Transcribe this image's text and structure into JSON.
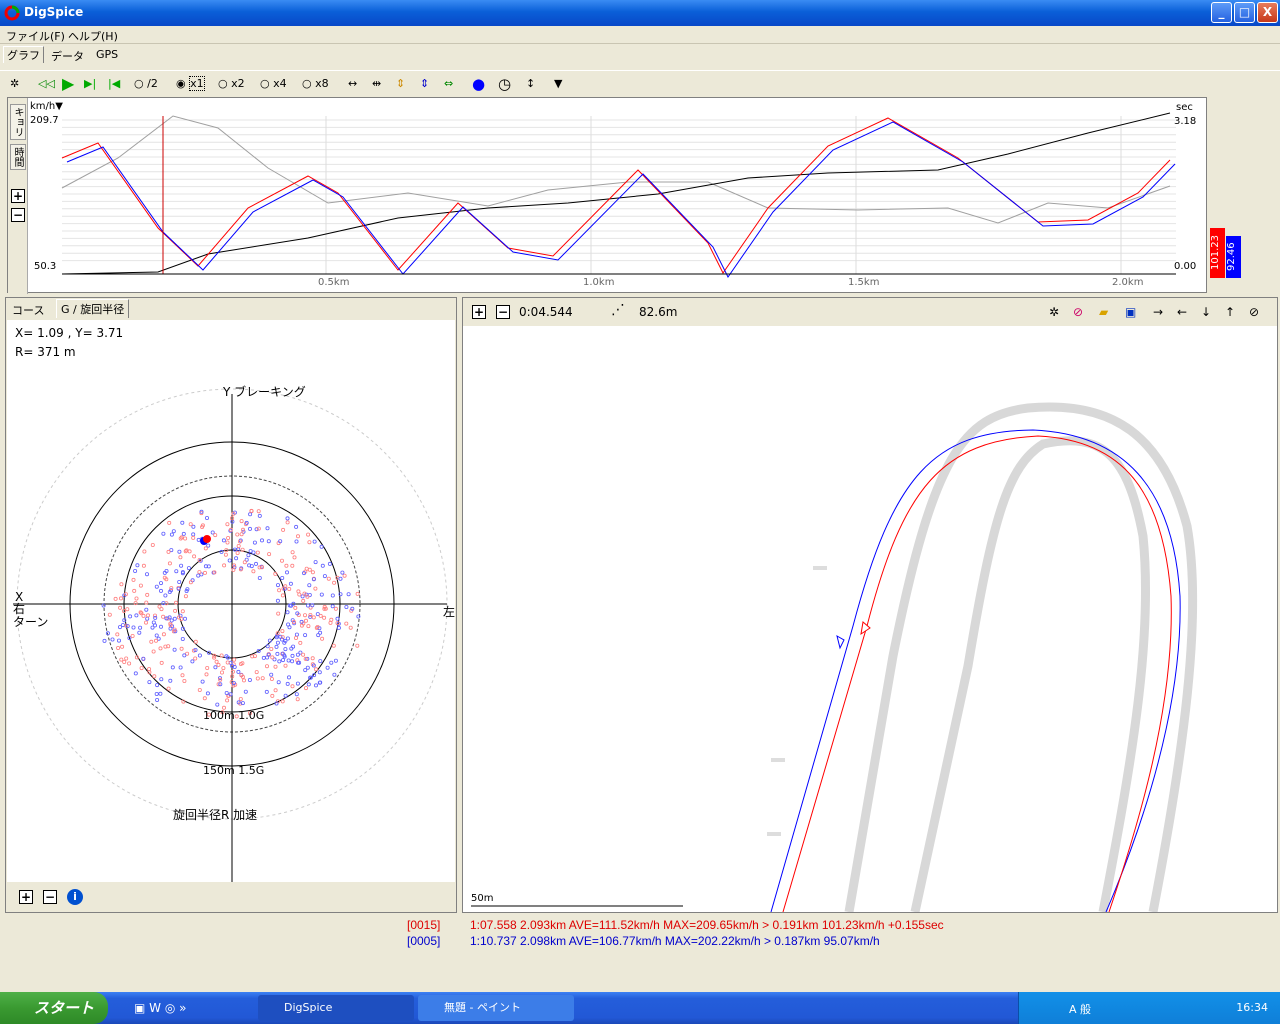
{
  "window": {
    "title": "DigSpice",
    "min": "_",
    "max": "□",
    "close": "X"
  },
  "menu": [
    {
      "label": "ファイル(F)"
    },
    {
      "label": "ヘルプ(H)"
    }
  ],
  "tabs": [
    {
      "label": "グラフ"
    },
    {
      "label": "データ"
    },
    {
      "label": "GPS"
    }
  ],
  "toolbar": {
    "speeds": [
      {
        "label": "/2"
      },
      {
        "label": "x1"
      },
      {
        "label": "x2"
      },
      {
        "label": "x4"
      },
      {
        "label": "x8"
      }
    ]
  },
  "graph": {
    "ylabel_left": "km/h▼",
    "ymax_left": "209.7",
    "ymin_left": "50.3",
    "ylabel_right": "sec",
    "ymax_right": "3.18",
    "ymin_right": "0.00",
    "vtab1": "キョリ",
    "vtab2": "時間",
    "xticks": [
      "0.5km",
      "1.0km",
      "1.5km",
      "2.0km"
    ],
    "legend_red": "101.23",
    "legend_blue": "92.46",
    "colors": {
      "red": "#ff0000",
      "blue": "#0000ff",
      "gray": "#a0a0a0",
      "black": "#000000"
    }
  },
  "gpanel": {
    "tabs": [
      {
        "label": "コース"
      },
      {
        "label": "G / 旋回半径"
      }
    ],
    "readout_xy": "X=  1.09  , Y=   3.71",
    "readout_r": "R= 371 m",
    "label_top": "Y ブレーキング",
    "label_x": "X",
    "label_right_turn": "右\nターン",
    "label_left": "左",
    "label_100": "100m  1.0G",
    "label_150": "150m  1.5G",
    "label_bottom": "旋回半径R  加速"
  },
  "map": {
    "time": "0:04.544",
    "distance": "82.6m",
    "scale": "50m"
  },
  "status": {
    "lap1_id": "[0015]",
    "lap1_text": "1:07.558  2.093km  AVE=111.52km/h  MAX=209.65km/h  >  0.191km  101.23km/h  +0.155sec",
    "lap2_id": "[0005]",
    "lap2_text": "1:10.737  2.098km  AVE=106.77km/h  MAX=202.22km/h  >  0.187km  95.07km/h"
  },
  "taskbar": {
    "start": "スタート",
    "tasks": [
      {
        "label": "DigSpice"
      },
      {
        "label": "無題 - ペイント"
      }
    ],
    "clock": "16:34",
    "ime": "A 般"
  }
}
